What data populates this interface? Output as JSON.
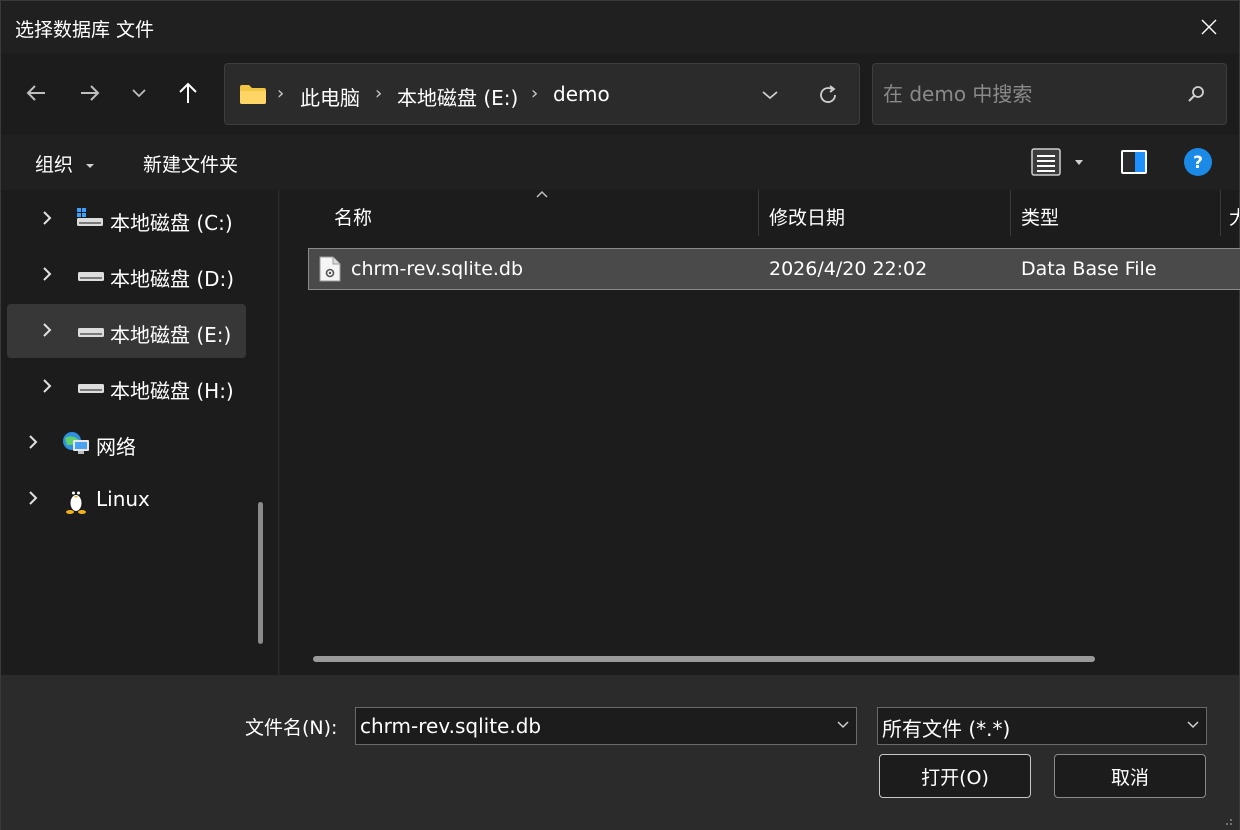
{
  "window": {
    "title": "选择数据库 文件"
  },
  "address": {
    "crumbs": [
      "此电脑",
      "本地磁盘 (E:)",
      "demo"
    ]
  },
  "search": {
    "placeholder": "在 demo 中搜索"
  },
  "toolbar": {
    "organize": "组织",
    "new_folder": "新建文件夹"
  },
  "nav": {
    "items": [
      {
        "label": "本地磁盘 (C:)",
        "icon": "windows-drive-icon"
      },
      {
        "label": "本地磁盘 (D:)",
        "icon": "drive-icon"
      },
      {
        "label": "本地磁盘 (E:)",
        "icon": "drive-icon",
        "selected": true
      },
      {
        "label": "本地磁盘 (H:)",
        "icon": "drive-icon"
      },
      {
        "label": "网络",
        "icon": "network-icon"
      },
      {
        "label": "Linux",
        "icon": "linux-penguin-icon"
      }
    ]
  },
  "columns": {
    "name": "名称",
    "modified": "修改日期",
    "type": "类型",
    "size": "大"
  },
  "files": [
    {
      "name": "chrm-rev.sqlite.db",
      "modified": "2026/4/20 22:02",
      "type": "Data Base File"
    }
  ],
  "bottom": {
    "filename_label": "文件名(N):",
    "filename_value": "chrm-rev.sqlite.db",
    "filetype_value": "所有文件 (*.*)",
    "open_label": "打开(O)",
    "cancel_label": "取消"
  },
  "colors": {
    "accent": "#0078d4",
    "folder": "#f4c542",
    "selection": "#4a4a4a"
  }
}
